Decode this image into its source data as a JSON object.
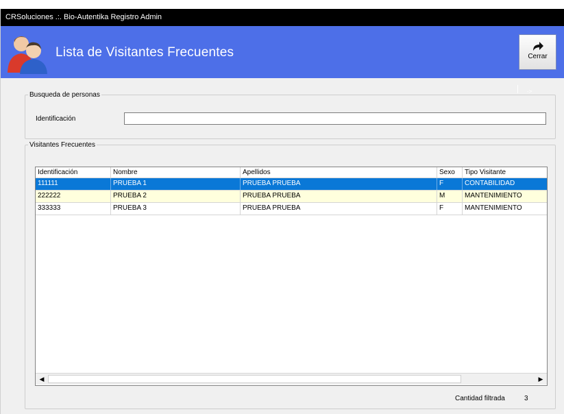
{
  "window": {
    "title": "CRSoluciones .:. Bio-Autentika Registro Admin"
  },
  "header": {
    "title": "Lista de Visitantes Frecuentes",
    "icon": "users-icon",
    "close_label": "Cerrar",
    "close_icon": "redo-arrow-icon",
    "arrow_mark": "->",
    "accent_color": "#4d6fe8"
  },
  "search": {
    "group_label": "Busqueda de personas",
    "id_label": "Identificación",
    "id_value": ""
  },
  "visitors": {
    "group_label": "Visitantes Frecuentes",
    "columns": [
      "Identificación",
      "Nombre",
      "Apellidos",
      "Sexo",
      "Tipo Visitante"
    ],
    "rows": [
      [
        "111111",
        "PRUEBA 1",
        "PRUEBA PRUEBA",
        "F",
        "CONTABILIDAD"
      ],
      [
        "222222",
        "PRUEBA 2",
        "PRUEBA PRUEBA",
        "M",
        "MANTENIMIENTO"
      ],
      [
        "333333",
        "PRUEBA 3",
        "PRUEBA PRUEBA",
        "F",
        "MANTENIMIENTO"
      ]
    ],
    "selected_row_color": "#0a78d7",
    "alt_row_color": "#ffffdd"
  },
  "footer": {
    "count_label": "Cantidad filtrada",
    "count_value": "3"
  }
}
